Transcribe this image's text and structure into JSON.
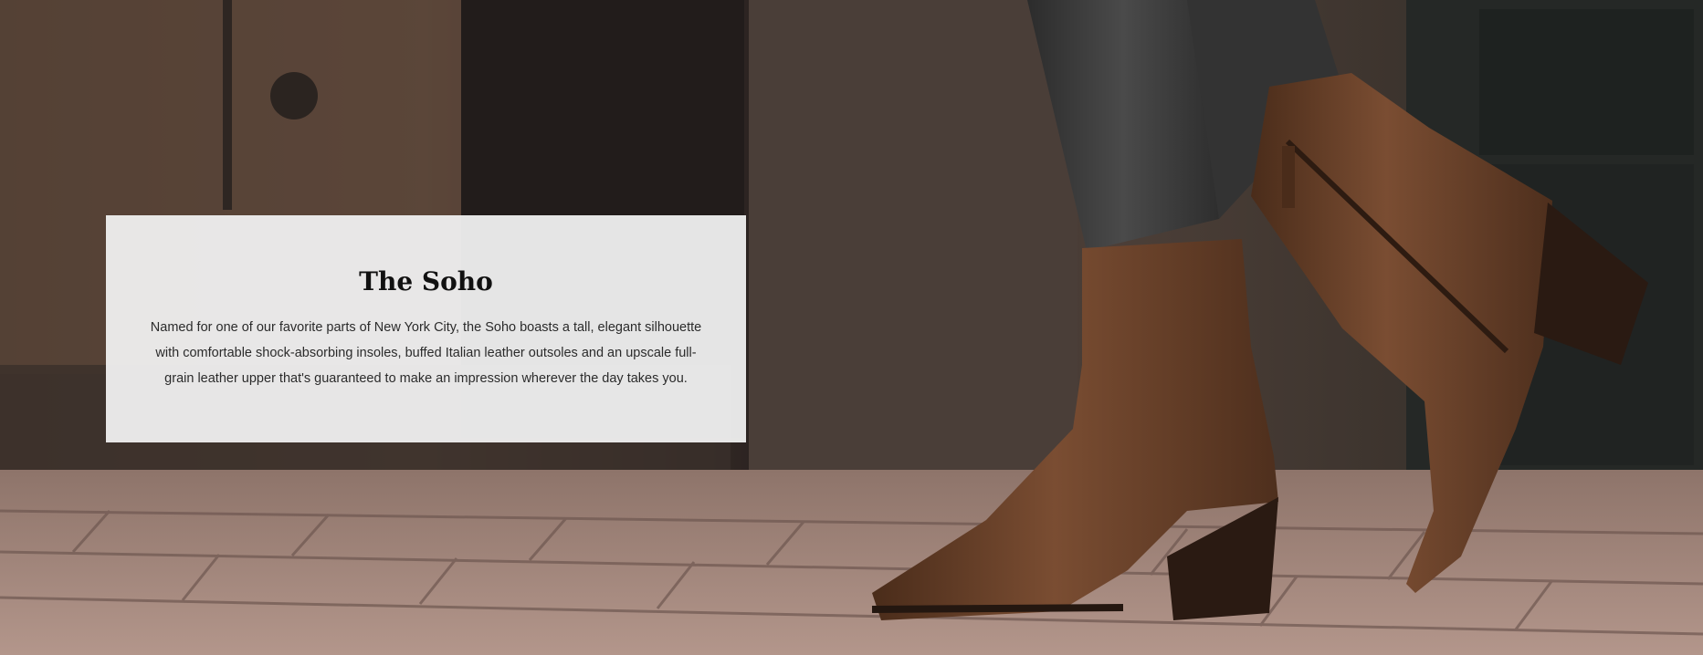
{
  "hero": {
    "image_subject": "pair-of-brown-leather-ankle-boots-on-brick-sidewalk",
    "colors": {
      "card_background": "#f0f0f0",
      "heading": "#111111",
      "body_text": "#2b2b2b",
      "boot_leather": "#6b4128",
      "boot_heel": "#2a1a12",
      "denim": "#3b3b3b",
      "brick": "#a7877a"
    }
  },
  "card": {
    "title": "The Soho",
    "description": "Named for one of our favorite parts of New York City, the Soho boasts a tall, elegant silhouette with comfortable shock-absorbing insoles, buffed Italian leather outsoles and an upscale full-grain leather upper that's guaranteed to make an impression wherever the day takes you."
  }
}
